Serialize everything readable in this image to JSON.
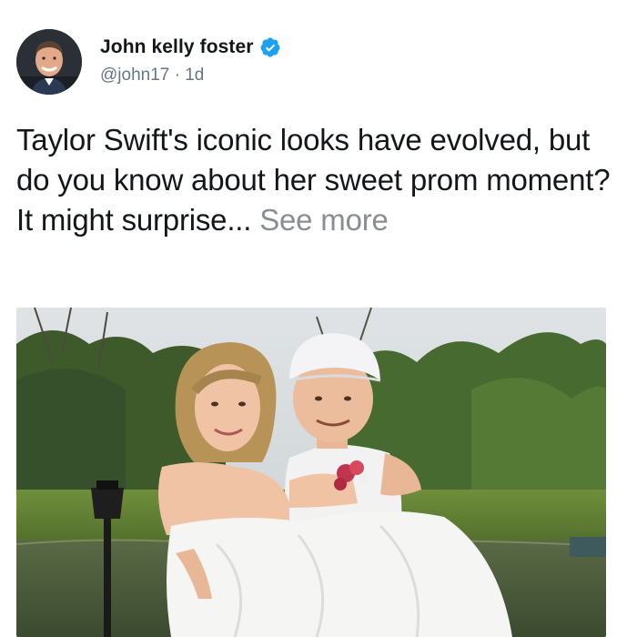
{
  "tweet": {
    "author": {
      "display_name": "John kelly foster",
      "verified_icon": "verified-badge-icon",
      "handle": "@john17",
      "separator": " · ",
      "age": "1d"
    },
    "text": "Taylor Swift's iconic looks have evolved, but do you know about her sweet prom moment? It might surprise... ",
    "see_more_label": "See more",
    "colors": {
      "primary_text": "#14171a",
      "secondary_text": "#657786",
      "verified": "#1da1f2",
      "see_more": "#8a8d91"
    }
  }
}
